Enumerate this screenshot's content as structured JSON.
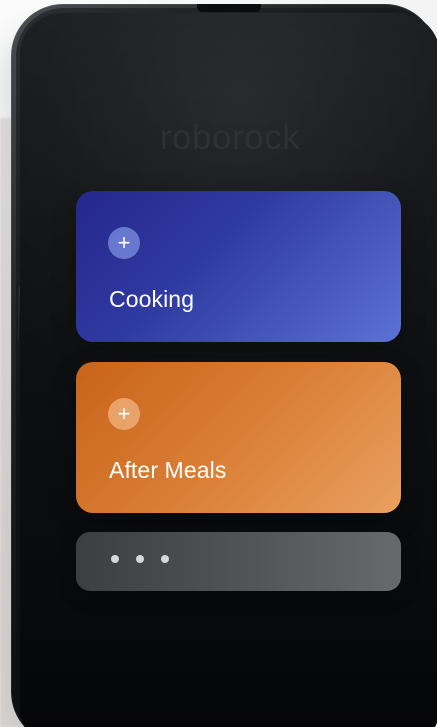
{
  "app": {
    "brand_text": "roborock"
  },
  "cards": [
    {
      "label": "Cooking",
      "plus_icon": "+",
      "color_start": "#24278c",
      "color_end": "#5c72d6"
    },
    {
      "label": "After Meals",
      "plus_icon": "+",
      "color_start": "#c86419",
      "color_end": "#e9a05f"
    }
  ],
  "more_card": {
    "icon": "more-dots-icon"
  }
}
